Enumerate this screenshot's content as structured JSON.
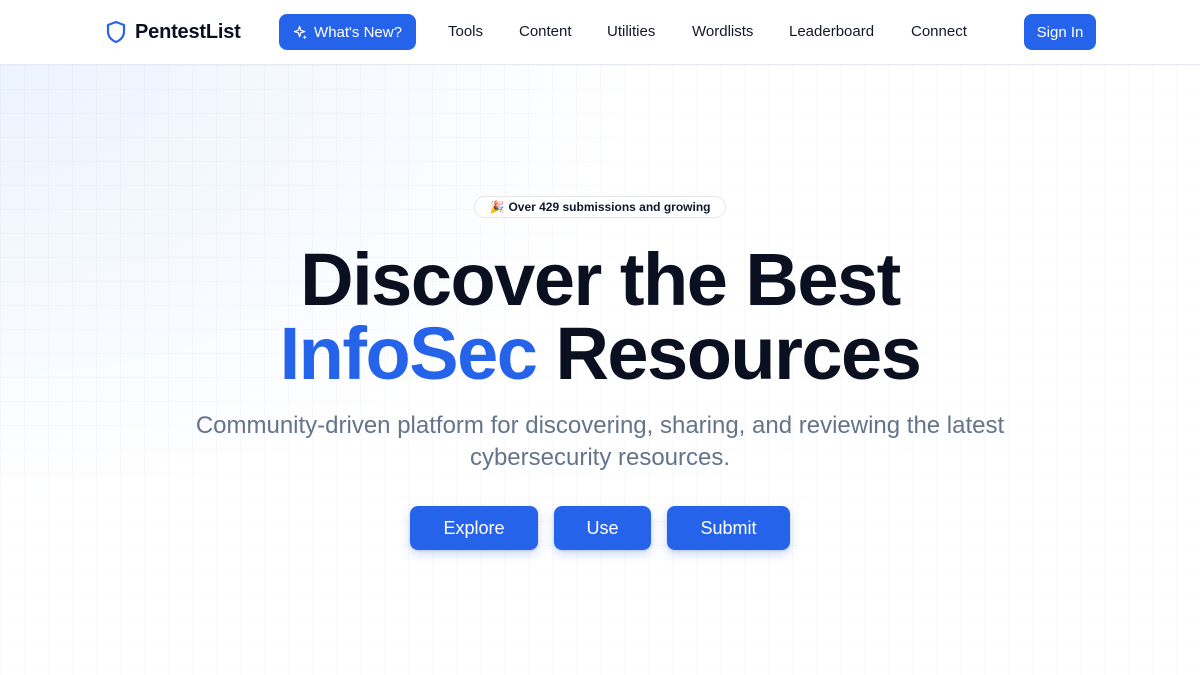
{
  "header": {
    "brand": "PentestList",
    "whats_new": "What's New?",
    "nav": [
      "Tools",
      "Content",
      "Utilities",
      "Wordlists",
      "Leaderboard",
      "Connect"
    ],
    "sign_in": "Sign In"
  },
  "hero": {
    "badge_emoji": "🎉",
    "badge_text": "Over 429 submissions and growing",
    "headline_line1": "Discover the Best",
    "headline_accent": "InfoSec",
    "headline_line2_rest": "Resources",
    "subtitle": "Community-driven platform for discovering, sharing, and reviewing the latest cybersecurity resources.",
    "buttons": [
      "Explore",
      "Use",
      "Submit"
    ]
  },
  "colors": {
    "accent": "#2563eb",
    "text": "#0b1020",
    "muted": "#64748b"
  },
  "icons": {
    "brand": "shield-icon",
    "whats_new": "sparkles-icon"
  }
}
